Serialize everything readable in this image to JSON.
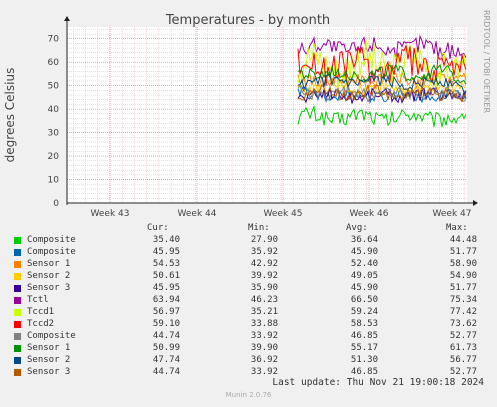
{
  "chart_data": {
    "type": "line",
    "title": "Temperatures - by month",
    "ylabel": "degrees Celsius",
    "ylim": [
      0,
      75
    ],
    "yticks": [
      "0",
      "10",
      "20",
      "30",
      "40",
      "50",
      "60",
      "70"
    ],
    "xticks": [
      "Week 43",
      "Week 44",
      "Week 45",
      "Week 46",
      "Week 47"
    ],
    "grid": true,
    "watermark": "RRDTOOL / TOBI OETIKER",
    "legend_headers": {
      "cur": "Cur:",
      "min": "Min:",
      "avg": "Avg:",
      "max": "Max:"
    },
    "series": [
      {
        "name": "Composite",
        "color": "#00cc00",
        "cur": "35.40",
        "min": "27.90",
        "avg": "36.64",
        "max": "44.48"
      },
      {
        "name": "Composite",
        "color": "#0066b3",
        "cur": "45.95",
        "min": "35.92",
        "avg": "45.90",
        "max": "51.77"
      },
      {
        "name": "Sensor 1",
        "color": "#ff8000",
        "cur": "54.53",
        "min": "42.92",
        "avg": "52.40",
        "max": "58.90"
      },
      {
        "name": "Sensor 2",
        "color": "#ffcc00",
        "cur": "50.61",
        "min": "39.92",
        "avg": "49.05",
        "max": "54.90"
      },
      {
        "name": "Sensor 3",
        "color": "#330099",
        "cur": "45.95",
        "min": "35.90",
        "avg": "45.90",
        "max": "51.77"
      },
      {
        "name": "Tctl",
        "color": "#990099",
        "cur": "63.94",
        "min": "46.23",
        "avg": "66.50",
        "max": "75.34"
      },
      {
        "name": "Tccd1",
        "color": "#ccff00",
        "cur": "56.97",
        "min": "35.21",
        "avg": "59.24",
        "max": "77.42"
      },
      {
        "name": "Tccd2",
        "color": "#ff0000",
        "cur": "59.10",
        "min": "33.88",
        "avg": "58.53",
        "max": "73.62"
      },
      {
        "name": "Composite",
        "color": "#808080",
        "cur": "44.74",
        "min": "33.92",
        "avg": "46.85",
        "max": "52.77"
      },
      {
        "name": "Sensor 1",
        "color": "#008f00",
        "cur": "50.99",
        "min": "39.90",
        "avg": "55.17",
        "max": "61.73"
      },
      {
        "name": "Sensor 2",
        "color": "#00487d",
        "cur": "47.74",
        "min": "36.92",
        "avg": "51.30",
        "max": "56.77"
      },
      {
        "name": "Sensor 3",
        "color": "#b35a00",
        "cur": "44.74",
        "min": "33.92",
        "avg": "46.85",
        "max": "52.77"
      }
    ]
  },
  "footer": {
    "last_update": "Last update: Thu Nov 21 19:00:18 2024",
    "version": "Munin 2.0.76"
  }
}
